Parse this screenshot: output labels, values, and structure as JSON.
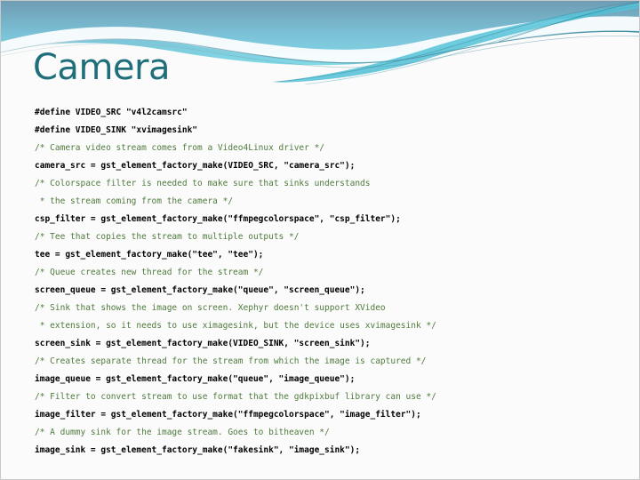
{
  "slide": {
    "title": "Camera",
    "theme": {
      "title_color": "#1f6f7a",
      "comment_color": "#4e7a3c",
      "code_color": "#000000",
      "band_gradient_start": "#6f9cb4",
      "band_gradient_end": "#7fe9ec",
      "background": "#fbfbfb",
      "border": "#c9c9c9"
    },
    "code_lines": [
      {
        "kind": "code",
        "text": "#define VIDEO_SRC \"v4l2camsrc\""
      },
      {
        "kind": "code",
        "text": "#define VIDEO_SINK \"xvimagesink\""
      },
      {
        "kind": "comment",
        "text": "/* Camera video stream comes from a Video4Linux driver */"
      },
      {
        "kind": "code",
        "text": "camera_src = gst_element_factory_make(VIDEO_SRC, \"camera_src\");"
      },
      {
        "kind": "comment",
        "text": "/* Colorspace filter is needed to make sure that sinks understands"
      },
      {
        "kind": "comment",
        "text": " * the stream coming from the camera */"
      },
      {
        "kind": "code",
        "text": "csp_filter = gst_element_factory_make(\"ffmpegcolorspace\", \"csp_filter\");"
      },
      {
        "kind": "comment",
        "text": "/* Tee that copies the stream to multiple outputs */"
      },
      {
        "kind": "code",
        "text": "tee = gst_element_factory_make(\"tee\", \"tee\");"
      },
      {
        "kind": "comment",
        "text": "/* Queue creates new thread for the stream */"
      },
      {
        "kind": "code",
        "text": "screen_queue = gst_element_factory_make(\"queue\", \"screen_queue\");"
      },
      {
        "kind": "comment",
        "text": "/* Sink that shows the image on screen. Xephyr doesn't support XVideo"
      },
      {
        "kind": "comment",
        "text": " * extension, so it needs to use ximagesink, but the device uses xvimagesink */"
      },
      {
        "kind": "code",
        "text": "screen_sink = gst_element_factory_make(VIDEO_SINK, \"screen_sink\");"
      },
      {
        "kind": "comment",
        "text": "/* Creates separate thread for the stream from which the image is captured */"
      },
      {
        "kind": "code",
        "text": "image_queue = gst_element_factory_make(\"queue\", \"image_queue\");"
      },
      {
        "kind": "comment",
        "text": "/* Filter to convert stream to use format that the gdkpixbuf library can use */"
      },
      {
        "kind": "code",
        "text": "image_filter = gst_element_factory_make(\"ffmpegcolorspace\", \"image_filter\");"
      },
      {
        "kind": "comment",
        "text": "/* A dummy sink for the image stream. Goes to bitheaven */"
      },
      {
        "kind": "code",
        "text": "image_sink = gst_element_factory_make(\"fakesink\", \"image_sink\");"
      }
    ]
  }
}
